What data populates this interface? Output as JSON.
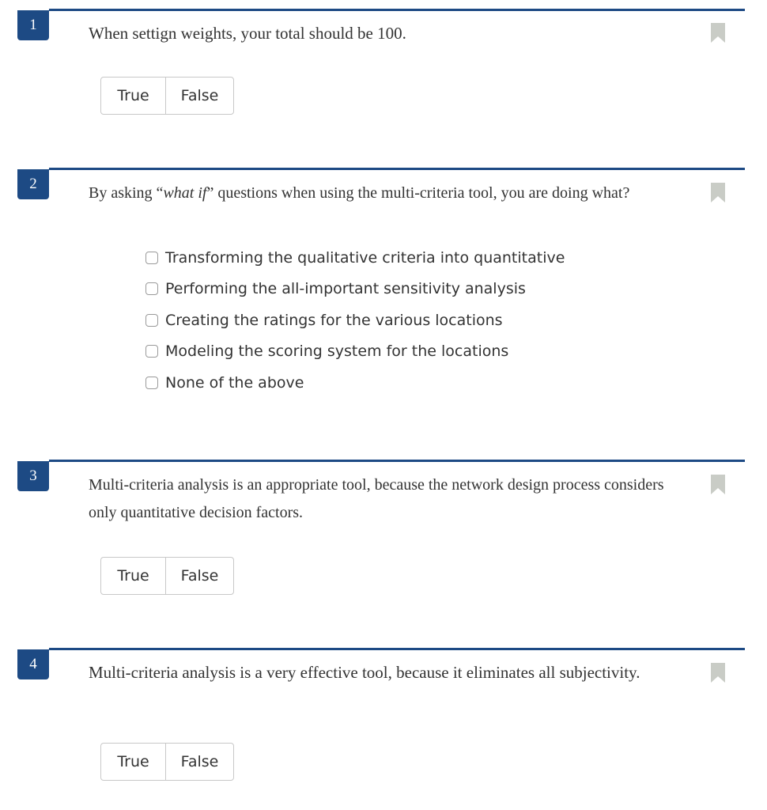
{
  "colors": {
    "accent": "#1d4a84",
    "bookmark": "#c9ccc6",
    "text": "#333333",
    "border": "#c8c8c8"
  },
  "questions": [
    {
      "number": "1",
      "text": "When settign weights, your total should be 100.",
      "answers": {
        "true_label": "True",
        "false_label": "False"
      },
      "bookmark_icon": "bookmark-icon"
    },
    {
      "number": "2",
      "text_before": "By asking “",
      "text_emphasis": "what if",
      "text_after": "” questions when using the multi-criteria tool, you are doing what?",
      "options": [
        "Transforming the qualitative criteria into quantitative",
        "Performing the all-important sensitivity analysis",
        "Creating the ratings for the various locations",
        "Modeling the scoring system for the locations",
        "None of the above"
      ],
      "bookmark_icon": "bookmark-icon"
    },
    {
      "number": "3",
      "text": "Multi-criteria analysis is an appropriate tool, because the network design process considers only quantitative decision factors.",
      "answers": {
        "true_label": "True",
        "false_label": "False"
      },
      "bookmark_icon": "bookmark-icon"
    },
    {
      "number": "4",
      "text": "Multi-criteria analysis is a very effective tool, because it eliminates all subjectivity.",
      "answers": {
        "true_label": "True",
        "false_label": "False"
      },
      "bookmark_icon": "bookmark-icon"
    }
  ]
}
